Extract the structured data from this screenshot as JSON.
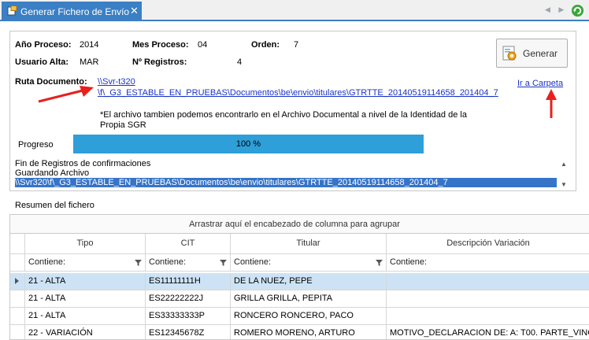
{
  "tab": {
    "title": "Generar Fichero de Envío",
    "close": "✕"
  },
  "nav": {
    "arrows": "◀ ▶"
  },
  "form": {
    "anio_label": "Año Proceso:",
    "anio_value": "2014",
    "mes_label": "Mes Proceso:",
    "mes_value": "04",
    "orden_label": "Orden:",
    "orden_value": "7",
    "usuario_label": "Usuario Alta:",
    "usuario_value": "MAR",
    "registros_label": "Nº Registros:",
    "registros_value": "4",
    "generar_label": "Generar",
    "ruta_label": "Ruta Documento:",
    "ruta_line1": "\\\\Svr-t320",
    "ruta_line2": "\\f\\_G3_ESTABLE_EN_PRUEBAS\\Documentos\\be\\envio\\titulares\\GTRTTE_20140519114658_201404_7",
    "ir_carpeta": "Ir a Carpeta",
    "note": "*El archivo tambien podemos encontrarlo en el Archivo Documental a nivel de la Identidad de la Propia SGR",
    "progress_label": "Progreso",
    "progress_value": 100,
    "progress_text": "100 %",
    "log": [
      "Fin de Registros de confirmaciones",
      "Guardando Archivo",
      "\\\\Svr320\\f\\_G3_ESTABLE_EN_PRUEBAS\\Documentos\\be\\envio\\titulares\\GTRTTE_20140519114658_201404_7"
    ]
  },
  "resumen": {
    "title": "Resumen del fichero",
    "group_hint": "Arrastrar aquí el encabezado de columna para agrupar",
    "columns": [
      "Tipo",
      "CIT",
      "Titular",
      "Descripción Variación"
    ],
    "filters": [
      "Contiene:",
      "Contiene:",
      "Contiene:",
      "Contiene:"
    ],
    "rows": [
      [
        "21 - ALTA",
        "ES11111111H",
        "DE LA NUEZ, PEPE",
        ""
      ],
      [
        "21 - ALTA",
        "ES22222222J",
        "GRILLA GRILLA, PEPITA",
        ""
      ],
      [
        "21 - ALTA",
        "ES33333333P",
        "RONCERO RONCERO, PACO",
        ""
      ],
      [
        "22 - VARIACIÓN",
        "ES12345678Z",
        "ROMERO MORENO, ARTURO",
        "MOTIVO_DECLARACION DE: A: T00. PARTE_VINC"
      ]
    ]
  },
  "colors": {
    "accent": "#3b7fc4",
    "progress": "#2e9fd8",
    "selection": "#3574c9",
    "row_selected": "#cde3f5",
    "arrow": "#e8201c"
  }
}
